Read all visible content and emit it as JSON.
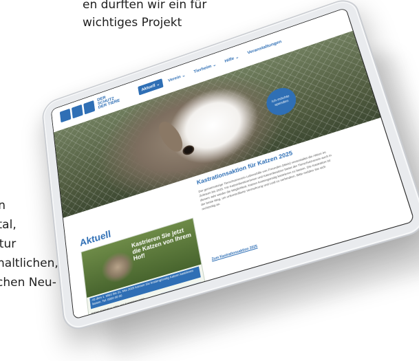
{
  "background_text": {
    "top_lines": [
      "en durften wir ein für",
      "wichtiges Projekt"
    ],
    "left_lines": [
      "ben",
      "gital,",
      "ntur",
      "haltlichen,",
      "chen Neu-"
    ]
  },
  "site": {
    "logo_text": "DER SCHUTZ DER TIERE",
    "nav": [
      {
        "label": "Aktuell ⌄",
        "active": true
      },
      {
        "label": "Verein ⌄",
        "active": false
      },
      {
        "label": "Tierheim ⌄",
        "active": false
      },
      {
        "label": "Hilfe ⌄",
        "active": false
      },
      {
        "label": "Veranstaltungen",
        "active": false
      }
    ],
    "cta": "Ich möchte spenden",
    "section_title": "Aktuell",
    "article": {
      "title": "Kastrationsaktion für Katzen 2025",
      "body": "Der gemeinnützige Tierschutzverein Lebenshilfe von Freunden (Weis) veranstaltet die Aktion im Zeitraum bis 2025. Für Katzenbesitzerinnen und Katzenbesitzer bietet der Tierschutzverein auch in diesem Jahr wieder die Möglichkeit, Katzen kostengünstig kastrieren zu lassen. Die Kastration ist der beste Weg, um unkontrollierte Vermehrung und Leid zu verhindern. Bitte melden Sie sich rechtzeitig an.",
      "link": "Zum Kastrationsaktion 2025"
    },
    "flyer": {
      "headline": "Kastrieren Sie jetzt die Katzen von Ihrem Hof!",
      "info": "Ab dem 1. März bis 31. Mai 2025 können Sie kostengünstig Katzen kastrieren lassen. Tel. 0000 00 00",
      "small": "Katzen-Kastration: Infos und Anmeldung beim Tierschutzverein"
    }
  }
}
